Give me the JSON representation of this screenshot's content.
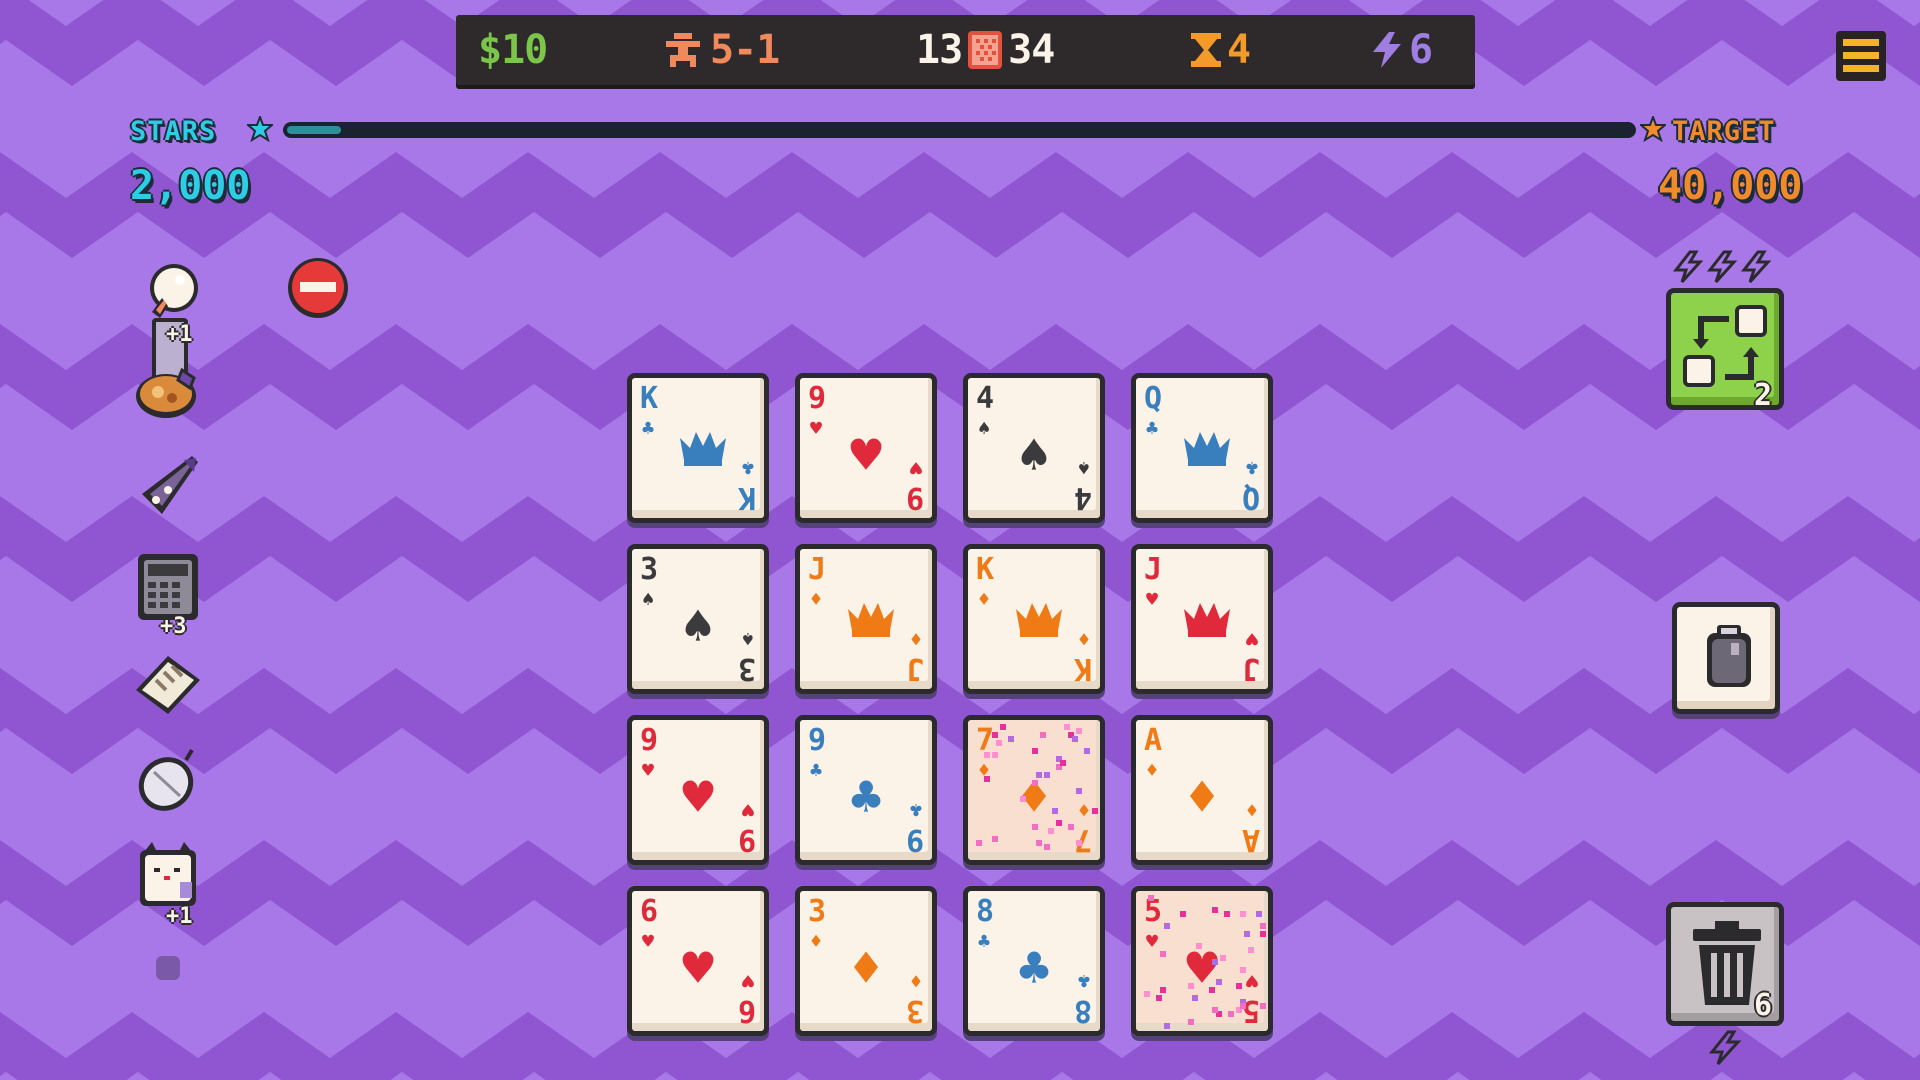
{
  "topbar": {
    "money": "$10",
    "stage": "5-1",
    "deck": {
      "left": "13",
      "right": "34"
    },
    "hands": "4",
    "energy": "6"
  },
  "score": {
    "stars_label": "STARS",
    "stars_value": "2,000",
    "target_label": "TARGET",
    "target_value": "40,000",
    "progress_fraction": 0.04
  },
  "colors": {
    "background": "#a878e8",
    "zigzag": "#9056d2",
    "red": "#e02a3b",
    "orange": "#f07a16",
    "blue": "#3a7fbd",
    "black": "#3b3a3c",
    "green_button": "#8ed14a",
    "stars": "#2ecde6",
    "target": "#f18a2a"
  },
  "sidebar": {
    "items": [
      {
        "icon": "lightbulb-icon",
        "badge": "+1"
      },
      {
        "icon": "pastry-icon",
        "badge": ""
      },
      {
        "icon": "rocket-icon",
        "badge": ""
      },
      {
        "icon": "calculator-icon",
        "badge": "+3"
      },
      {
        "icon": "bread-icon",
        "badge": ""
      },
      {
        "icon": "mouse-icon",
        "badge": ""
      },
      {
        "icon": "lucky-cat-icon",
        "badge": "+1"
      }
    ]
  },
  "swap_button": {
    "icon": "swap-icon",
    "count": "2",
    "energy_cost": 3
  },
  "item_button": {
    "icon": "jar-icon"
  },
  "trash_button": {
    "icon": "trash-icon",
    "count": "6",
    "energy_cost": 1
  },
  "cards": [
    {
      "rank": "K",
      "suit": "club",
      "face": true
    },
    {
      "rank": "9",
      "suit": "heart",
      "face": false
    },
    {
      "rank": "4",
      "suit": "spade",
      "face": false
    },
    {
      "rank": "Q",
      "suit": "club",
      "face": true
    },
    {
      "rank": "3",
      "suit": "spade",
      "face": false
    },
    {
      "rank": "J",
      "suit": "diamond",
      "face": true
    },
    {
      "rank": "K",
      "suit": "diamond",
      "face": true
    },
    {
      "rank": "J",
      "suit": "heart",
      "face": true
    },
    {
      "rank": "9",
      "suit": "heart",
      "face": false
    },
    {
      "rank": "9",
      "suit": "club",
      "face": false
    },
    {
      "rank": "7",
      "suit": "diamond",
      "face": false,
      "selected": true
    },
    {
      "rank": "A",
      "suit": "diamond",
      "face": false
    },
    {
      "rank": "6",
      "suit": "heart",
      "face": false
    },
    {
      "rank": "3",
      "suit": "diamond",
      "face": false
    },
    {
      "rank": "8",
      "suit": "club",
      "face": false
    },
    {
      "rank": "5",
      "suit": "heart",
      "face": false,
      "selected": true
    }
  ]
}
